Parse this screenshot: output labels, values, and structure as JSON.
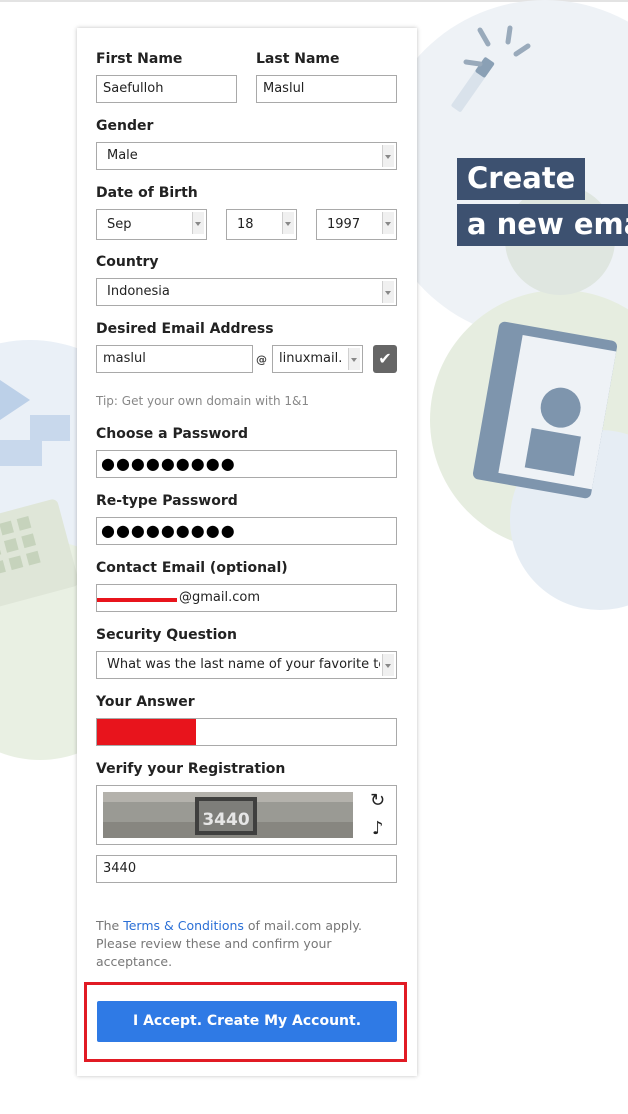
{
  "hero": {
    "line1": "Create",
    "line2": "a new ema"
  },
  "form": {
    "first_name": {
      "label": "First Name",
      "value": "Saefulloh"
    },
    "last_name": {
      "label": "Last Name",
      "value": "Maslul"
    },
    "gender": {
      "label": "Gender",
      "value": "Male"
    },
    "dob": {
      "label": "Date of Birth",
      "month": "Sep",
      "day": "18",
      "year": "1997"
    },
    "country": {
      "label": "Country",
      "value": "Indonesia"
    },
    "email": {
      "label": "Desired Email Address",
      "value": "maslul",
      "at": "@",
      "domain": "linuxmail.",
      "tip": "Tip: Get your own domain with 1&1"
    },
    "password": {
      "label": "Choose a Password",
      "value": "●●●●●●●●●"
    },
    "retype": {
      "label": "Re-type Password",
      "value": "●●●●●●●●●"
    },
    "contact": {
      "label": "Contact Email (optional)",
      "value": "@gmail.com"
    },
    "security": {
      "label": "Security Question",
      "value": "What was the last name of your favorite te"
    },
    "answer": {
      "label": "Your Answer",
      "value": ""
    },
    "verify": {
      "label": "Verify your Registration",
      "captcha_text": "3440",
      "value": "3440"
    },
    "terms": {
      "pre": "The ",
      "link": "Terms & Conditions",
      "post": " of mail.com apply. Please review these and confirm your acceptance."
    },
    "submit_label": "I Accept. Create My Account."
  },
  "colors": {
    "accent": "#2f7ae5",
    "hero_bg": "#3d5170",
    "highlight": "#e11b24"
  },
  "icons": {
    "checkmark": "check-icon",
    "refresh": "refresh-icon",
    "audio": "music-note-icon"
  }
}
